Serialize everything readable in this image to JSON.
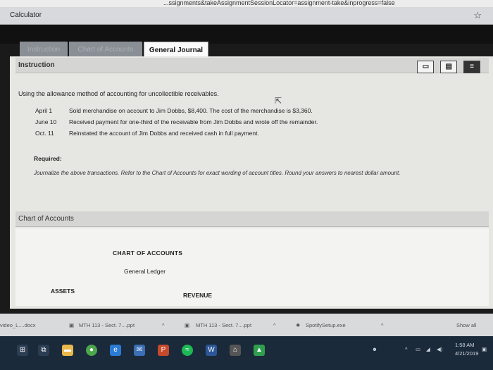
{
  "browser": {
    "url_fragment": "...ssignments&takeAssignmentSessionLocator=assignment-take&inprogress=false",
    "tab_label": "Calculator",
    "star_icon": "star-icon"
  },
  "tabs": [
    {
      "label": "Instruction"
    },
    {
      "label": "Chart of Accounts"
    },
    {
      "label": "General Journal"
    }
  ],
  "instruction": {
    "header": "Instruction",
    "intro": "Using the allowance method of accounting for uncollectible receivables.",
    "transactions": [
      {
        "date": "April 1",
        "text": "Sold merchandise on account to Jim Dobbs, $8,400. The cost of the merchandise is $3,360."
      },
      {
        "date": "June 10",
        "text": "Received payment for one-third of the receivable from Jim Dobbs and wrote off the remainder."
      },
      {
        "date": "Oct. 11",
        "text": "Reinstated the account of Jim Dobbs and received cash in full payment."
      }
    ],
    "required_label": "Required:",
    "required_text": "Journalize the above transactions. Refer to the Chart of Accounts for exact wording of account titles. Round your answers to nearest dollar amount."
  },
  "chart_of_accounts": {
    "header": "Chart of Accounts",
    "title": "CHART OF ACCOUNTS",
    "subtitle": "General Ledger",
    "assets": "ASSETS",
    "revenue": "REVENUE"
  },
  "downloads": [
    {
      "label": "video_L....docx"
    },
    {
      "label": "MTH 113 - Sect. 7....ppt"
    },
    {
      "label": "MTH 113 - Sect. 7....ppt"
    },
    {
      "label": "SpotifySetup.exe"
    },
    {
      "label": "Show all"
    }
  ],
  "taskbar": {
    "time": "1:58 AM",
    "date": "4/21/2019"
  }
}
